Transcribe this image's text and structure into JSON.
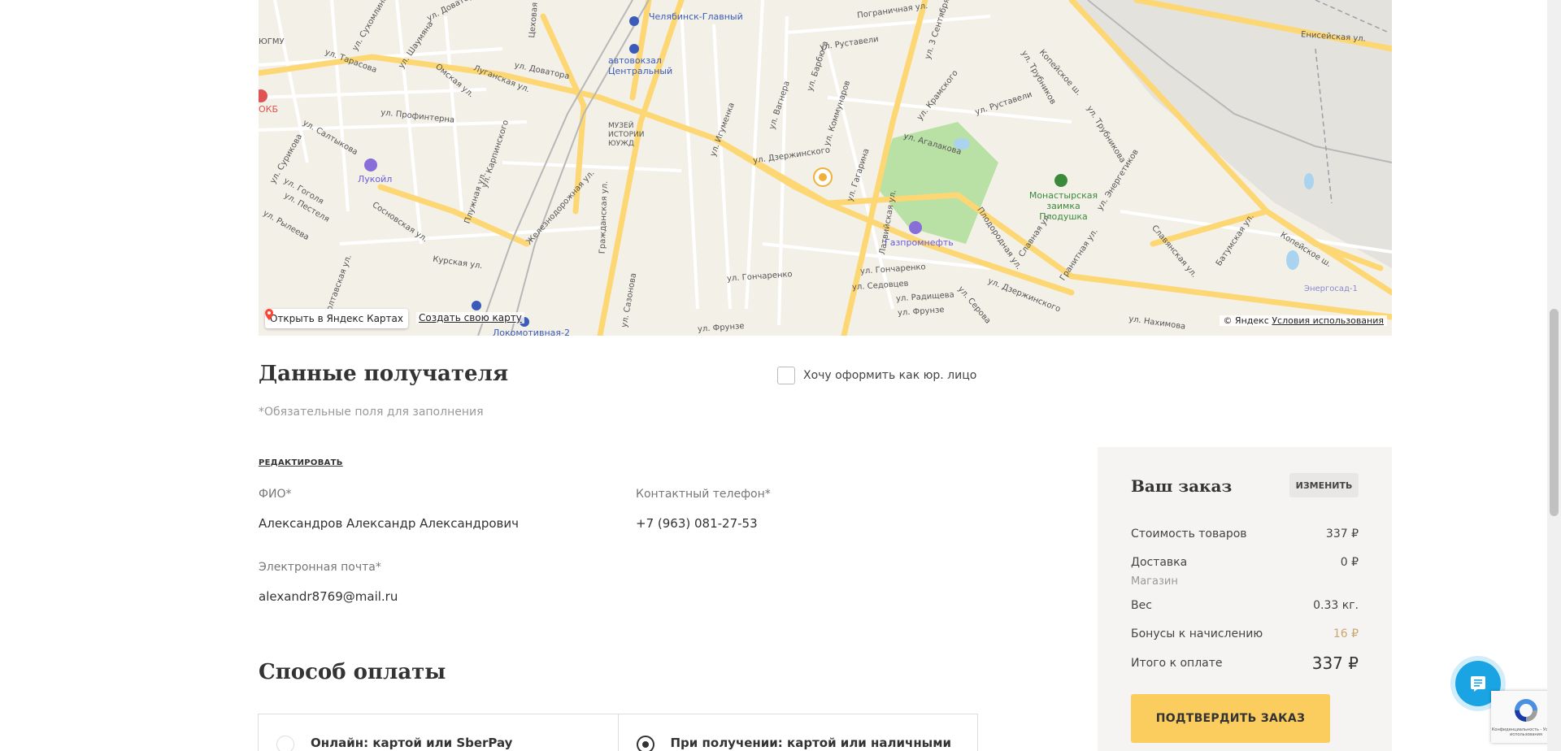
{
  "map": {
    "open_in_yandex": "Открыть в Яндекс Картах",
    "create_map": "Создать свою карту",
    "copyright": "© Яндекс",
    "terms": "Условия использования",
    "labels": {
      "chelyabinsk_main": "Челябинск-Главный",
      "bus_station": "автовокзал Центральный",
      "museum": "МУЗЕЙ ИСТОРИИ ЮУЖД",
      "lukoil": "Лукойл",
      "gazpromneft": "Газпромнефть",
      "monastery": "Монастырская заимка Плодушка",
      "energosad": "Энергосад-1",
      "lokomotivnaya": "Локомотивная-2",
      "okb": "ОКБ",
      "gmu": "ЮГМУ",
      "dovatora": "ул. Доватора",
      "dovatora2": "ул. Доватора",
      "profinterna": "ул. Профинтерна",
      "saltykova": "ул. Салтыкова",
      "dzerzhinskogo": "ул. Дзержинского",
      "dzerzhinskogo2": "ул. Дзержинского",
      "rustaveli": "ул. Руставели",
      "rustaveli2": "ул. Руставели",
      "agalakova": "ул. Агалакова",
      "igumenka": "ул. Игуменка",
      "gagarina": "ул. Гагарина",
      "goncharenko": "ул. Гончаренко",
      "goncharenko2": "ул. Гончаренко",
      "kopeyskoe": "Копейское ш.",
      "kopeyskoe2": "Копейское ш.",
      "eniseyskaya": "Енисейская ул.",
      "trubnikov": "ул. Трубников",
      "trubnikova": "ул. Трубникова",
      "energetikov": "ул. Энергетиков",
      "zheleznodorozhnaya": "Железнодорожная ул.",
      "kurskaya": "Курская ул.",
      "sosnovskaya": "Сосновская ул.",
      "grazhdanskaya": "Гражданская ул.",
      "sedovtsev": "ул. Седовцев",
      "radishcheva": "ул. Радищева",
      "frunze": "ул. Фрунзе",
      "frunze2": "ул. Фрунзе",
      "nakhimova": "ул. Нахимова",
      "batumskaya": "Батумская ул.",
      "slavyanskaya": "Славянская ул.",
      "slavnaya": "Славная ул.",
      "granitnaya": "Гранитная ул.",
      "plodorodnaya": "Плодородная ул.",
      "latviyskaya": "Латвийская ул.",
      "serova": "ул. Серова",
      "kommunarov": "ул. Коммунаров",
      "barbyusa": "ул. Барбюса",
      "vagnera": "ул. Вагнера",
      "kramskogo": "ул. Крамского",
      "karpinskogo": "ул. Карпинского",
      "pluzhnaya": "Плужная ул.",
      "omskaya": "Омская ул.",
      "luganskaya": "Луганская ул.",
      "shaumyana": "ул. Шаумяна",
      "tarasova": "ул. Тарасова",
      "gogolya": "ул. Гоголя",
      "pestelya": "ул. Пестеля",
      "ryleeva": "ул. Рылеева",
      "surikova": "ул. Сурикова",
      "poltavskaya": "Полтавская ул.",
      "sazonova": "ул. Сазонова",
      "tsekhovaya": "Цеховая ул.",
      "pogranichnaya": "Пограничная ул.",
      "sentyabrya": "ул. 3 Сентября",
      "sukhomlinova": "ул. Сухомлинова"
    }
  },
  "recipient": {
    "title": "Данные получателя",
    "legal_entity_label": "Хочу оформить как юр. лицо",
    "required_note": "*Обязательные поля для заполнения",
    "edit_label": "РЕДАКТИРОВАТЬ",
    "fio_label": "ФИО*",
    "fio_value": "Александров Александр Александрович",
    "phone_label": "Контактный телефон*",
    "phone_value": "+7 (963) 081-27-53",
    "email_label": "Электронная почта*",
    "email_value": "alexandr8769@mail.ru"
  },
  "payment": {
    "title": "Способ оплаты",
    "options": [
      {
        "label": "Онлайн: картой или SberPay",
        "selected": false
      },
      {
        "label": "При получении: картой или наличными",
        "selected": true
      }
    ]
  },
  "order": {
    "title": "Ваш заказ",
    "change_label": "ИЗМЕНИТЬ",
    "goods_label": "Стоимость товаров",
    "goods_value": "337 ₽",
    "delivery_label": "Доставка",
    "delivery_value": "0 ₽",
    "delivery_method": "Магазин",
    "weight_label": "Вес",
    "weight_value": "0.33 кг.",
    "bonus_label": "Бонусы к начислению",
    "bonus_value": "16 ₽",
    "total_label": "Итого к оплате",
    "total_value": "337 ₽",
    "confirm_label": "ПОДТВЕРДИТЬ ЗАКАЗ"
  },
  "recaptcha": {
    "text": "Конфиденциальность - Условия использования"
  },
  "colors": {
    "accent_button": "#fbcd5e",
    "chat_button": "#1aa4e4",
    "bonus": "#c8a870",
    "order_panel_bg": "#f5f4f2"
  },
  "icons": {
    "chat": "chat-icon",
    "map_pin": "map-pin-icon",
    "recaptcha": "recaptcha-icon"
  }
}
